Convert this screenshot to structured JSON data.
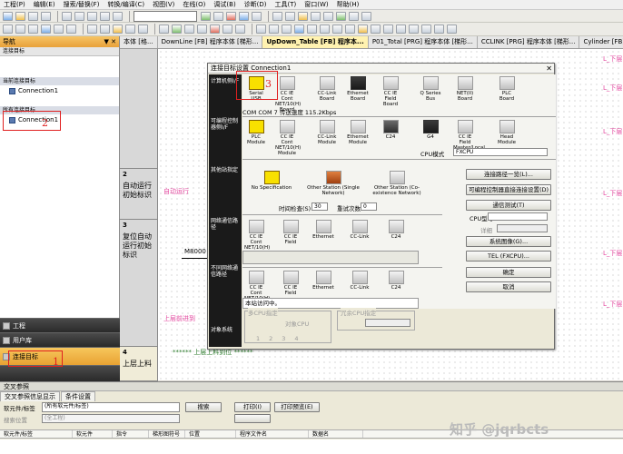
{
  "menu": [
    "工程(P)",
    "编辑(E)",
    "搜索/替换(F)",
    "转换/编译(C)",
    "视图(V)",
    "在线(O)",
    "调试(B)",
    "诊断(D)",
    "工具(T)",
    "窗口(W)",
    "帮助(H)"
  ],
  "nav": {
    "title": "导航",
    "pin": "▼ ✕",
    "subheader": "连接目标",
    "current_section": "当前连接目标",
    "current_item": "Connection1",
    "all_section": "所有连接目标",
    "all_item": "Connection1",
    "tabs": [
      {
        "label": "工程"
      },
      {
        "label": "用户库"
      },
      {
        "label": "连接目标"
      }
    ],
    "annotations": {
      "label2": "2",
      "label1": "1"
    }
  },
  "doc_tabs": [
    "本体 [格...",
    "DownLine [FB] 程序本体 [梯形...",
    "UpDown_Table [FB] 程序本...",
    "P01_Total [PRG] 程序本体 [梯形...",
    "CCLINK [PRG] 程序本体 [梯形...",
    "Cylinder [FB] 程序本"
  ],
  "rungs": [
    {
      "num": "2",
      "text": "自动运行初始标识"
    },
    {
      "num": "3",
      "text": "复位自动运行初始标识"
    },
    {
      "num": "4",
      "text": "上层上料"
    }
  ],
  "ladder": {
    "contact_label": "M8000",
    "pink1": "自动运行",
    "pink2": "上层前进到",
    "right_labels": [
      "L_下层",
      "L_下层",
      "L_下层",
      "L_下层",
      "L_下层",
      "L_下层"
    ],
    "bottom_note": "****** 上层上料到位 ******"
  },
  "dialog": {
    "title": "连接目标设置 Connection1",
    "close": "✕",
    "side_labels": [
      "计算机侧I/F",
      "可编程控制器侧I/F",
      "其他站指定",
      "网络通信路径",
      "不同网络通信路径",
      "对象系统"
    ],
    "pc_if": [
      "Serial USB",
      "CC IE Cont NET/10(H) Board",
      "CC-Link Board",
      "Ethernet Board",
      "CC IE Field Board",
      "Q Series Bus",
      "NET(II) Board",
      "PLC Board"
    ],
    "com_text": "COM  COM 7    传送速度  115.2Kbps",
    "plc_if": [
      "PLC Module",
      "CC IE Cont NET/10(H) Module",
      "CC-Link Module",
      "Ethernet Module",
      "C24",
      "G4",
      "CC IE Field Master/Local Module",
      "Head Module"
    ],
    "cpu_mode_label": "CPU模式",
    "cpu_mode_value": "FXCPU",
    "other_station": [
      "No Specification",
      "Other Station (Single Network)",
      "Other Station (Co-existence Network)"
    ],
    "timeout_label": "时间检查(S)",
    "timeout_value": "30",
    "retry_label": "重试次数",
    "retry_value": "0",
    "route1": [
      "CC IE Cont NET/10(H)",
      "CC IE Field",
      "Ethernet",
      "CC-Link",
      "C24"
    ],
    "route2": [
      "CC IE Cont NET/10(H)",
      "CC IE Field",
      "Ethernet",
      "CC-Link",
      "C24"
    ],
    "own_station": "本站访问中。",
    "multi_cpu": "多CPU指定",
    "target_cpu": "对象CPU",
    "redundant": "冗余CPU指定",
    "cpu_nums": [
      "1",
      "2",
      "3",
      "4"
    ],
    "buttons": [
      "连接路径一览(L)...",
      "可编程控制器直接连接设置(D)",
      "通信测试(T)",
      "系统图像(G)...",
      "TEL (FXCPU)...",
      "确定",
      "取消"
    ],
    "cpu_type_label": "CPU型号",
    "detail_label": "详细",
    "annotation": "3"
  },
  "xref": {
    "title": "交叉参照",
    "tabs": [
      "交叉参照信息显示",
      "条件设置"
    ],
    "search_label": "软元件/标签",
    "search_value": "(所有软元件/标签)",
    "search_btn": "搜索",
    "print_btn": "打印(I)",
    "print_preview": "打印预览(E)",
    "scope_label": "搜索位置",
    "scope_value": "(全工程)",
    "columns": [
      "软元件/标签",
      "软元件",
      "指令",
      "梯形图符号",
      "位置",
      "程序文件名",
      "数据名"
    ]
  },
  "watermark": "知乎 @jqrbcts"
}
